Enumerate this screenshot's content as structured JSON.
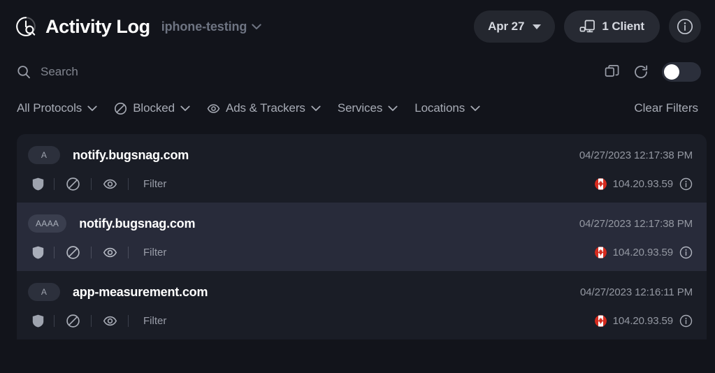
{
  "header": {
    "app_icon": "activity-log-icon",
    "title": "Activity Log",
    "profile": "iphone-testing",
    "profile_caret": "chevron-down-icon",
    "date_button": "Apr 27",
    "clients_button": "1 Client",
    "clients_icon": "devices-icon",
    "info_button_icon": "info-icon"
  },
  "search": {
    "icon": "search-icon",
    "value": "",
    "placeholder": "Search",
    "copy_icon": "copy-icon",
    "refresh_icon": "refresh-icon",
    "live_toggle": "off"
  },
  "filters": {
    "items": [
      {
        "label": "All Protocols",
        "icon": null
      },
      {
        "label": "Blocked",
        "icon": "block-circle-icon"
      },
      {
        "label": "Ads & Trackers",
        "icon": "eye-icon"
      },
      {
        "label": "Services",
        "icon": null
      },
      {
        "label": "Locations",
        "icon": null
      }
    ],
    "clear_label": "Clear Filters"
  },
  "log": {
    "row_actions": {
      "shield_icon": "shield-icon",
      "block_icon": "block-circle-icon",
      "eye_icon": "eye-icon",
      "filter_label": "Filter",
      "info_icon": "info-icon"
    },
    "entries": [
      {
        "type": "A",
        "domain": "notify.bugsnag.com",
        "timestamp": "04/27/2023 12:17:38 PM",
        "country": "CA",
        "ip": "104.20.93.59",
        "highlighted": false
      },
      {
        "type": "AAAA",
        "domain": "notify.bugsnag.com",
        "timestamp": "04/27/2023 12:17:38 PM",
        "country": "CA",
        "ip": "104.20.93.59",
        "highlighted": true
      },
      {
        "type": "A",
        "domain": "app-measurement.com",
        "timestamp": "04/27/2023 12:16:11 PM",
        "country": "CA",
        "ip": "104.20.93.59",
        "highlighted": false
      }
    ]
  },
  "colors": {
    "page_bg": "#12141b",
    "row_bg": "#1a1d26",
    "row_bg_alt": "#282b3a",
    "accent_text": "#ffffff",
    "muted_text": "#9498a2",
    "flag_red": "#d52b1e"
  }
}
